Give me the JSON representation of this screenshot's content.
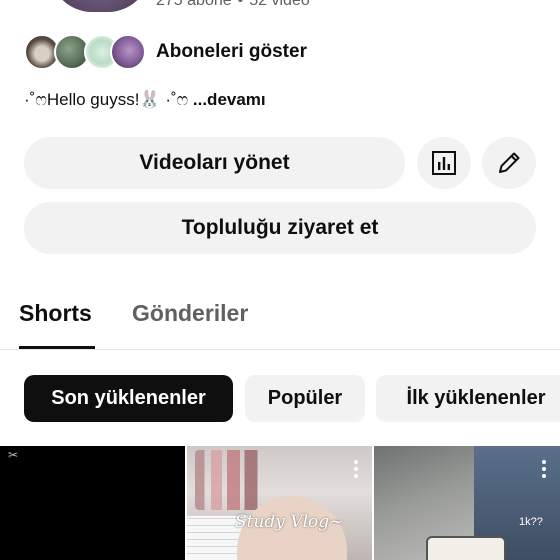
{
  "channel": {
    "stats": {
      "subscribers": "275 abone",
      "separator": "•",
      "videos": "52 video"
    },
    "subscribers_label": "Aboneleri göster",
    "bio": {
      "text": "·˚ෆHello guyss!🐰 ·˚ෆ",
      "more": "...devamı"
    }
  },
  "actions": {
    "manage_videos": "Videoları yönet",
    "stats_icon": "analytics-icon",
    "edit_icon": "pencil-icon",
    "visit_community": "Topluluğu ziyaret et"
  },
  "tabs": [
    {
      "label": "Shorts",
      "active": true
    },
    {
      "label": "Gönderiler",
      "active": false
    }
  ],
  "filters": [
    {
      "label": "Son yüklenenler",
      "selected": true
    },
    {
      "label": "Popüler",
      "selected": false
    },
    {
      "label": "İlk yüklenenler",
      "selected": false
    }
  ],
  "shorts": [
    {
      "overlay_text": ""
    },
    {
      "overlay_text": "Study Vlog~"
    },
    {
      "overlay_text": "",
      "views": "1k??"
    }
  ],
  "colors": {
    "active_chip_bg": "#0f0f0f",
    "chip_bg": "#f2f2f2",
    "secondary_text": "#606060"
  }
}
